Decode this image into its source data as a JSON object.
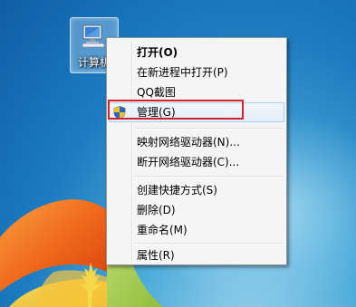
{
  "desktop": {
    "icon": {
      "name": "computer-icon",
      "label": "计算机"
    }
  },
  "context_menu": {
    "items": [
      {
        "label": "打开(O)",
        "bold": true
      },
      {
        "label": "在新进程中打开(P)"
      },
      {
        "label": "QQ截图"
      },
      {
        "label": "管理(G)",
        "icon": "uac-shield-icon",
        "highlighted": true
      },
      {
        "label": "映射网络驱动器(N)..."
      },
      {
        "label": "断开网络驱动器(C)..."
      },
      {
        "label": "创建快捷方式(S)"
      },
      {
        "label": "删除(D)"
      },
      {
        "label": "重命名(M)"
      },
      {
        "label": "属性(R)"
      }
    ]
  },
  "colors": {
    "highlight_border": "#d3222a",
    "menu_background": "#f5f5f5",
    "hover_border": "#aecff5"
  }
}
